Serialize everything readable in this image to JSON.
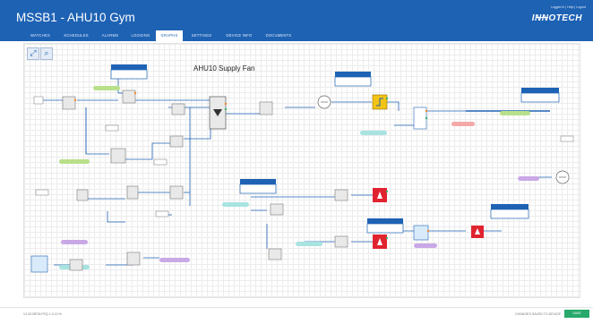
{
  "app": {
    "title": "MSSB1 - AHU10 Gym",
    "top_links": "Logged In  |  Help  |  Logout",
    "logo": "INNOTECH"
  },
  "nav": {
    "tabs": [
      "WATCHES",
      "SCHEDULES",
      "ALARMS",
      "LOGGING",
      "GRAPHS",
      "SETTINGS",
      "DEVICE INFO",
      "DOCUMENTS"
    ],
    "active": "GRAPHS"
  },
  "toolbar": {
    "fit_icon": "expand-arrows-icon",
    "zoom_icon": "magnifier-icon"
  },
  "diagram": {
    "title": "AHU10 Supply Fan"
  },
  "footer": {
    "left": "V1.00 BETA FEQ 1.0 10 %",
    "right": "CHANGES SAVED TO DEVICE",
    "button": "SAVE"
  },
  "colors": {
    "header": "#1e62b4",
    "wire": "#1e62b4",
    "alarm_red": "#e0242f",
    "value_yellow": "#f3c315",
    "save_green": "#27a96c",
    "tag_green": "#b8e08a",
    "tag_purple": "#c9a8e6",
    "tag_teal": "#a8e3e0",
    "tag_blue": "#a8c8f0"
  }
}
